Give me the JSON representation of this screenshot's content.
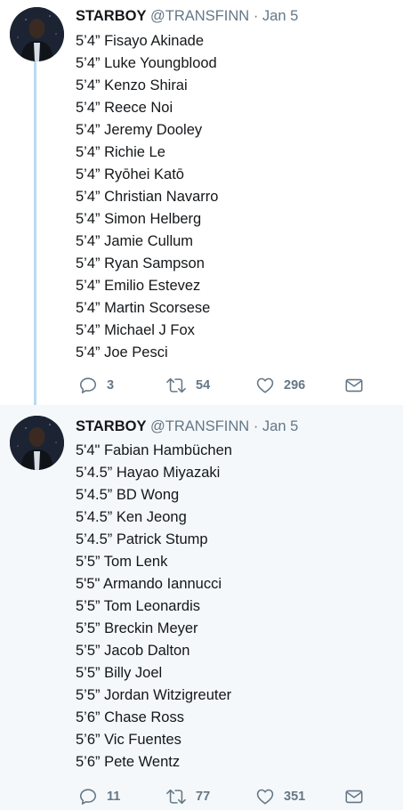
{
  "tweets": [
    {
      "author": {
        "name": "STARBOY",
        "handle": "@TRANSFINN",
        "separator": "·",
        "date": "Jan 5"
      },
      "lines": [
        "5’4” Fisayo Akinade",
        "5’4” Luke Youngblood",
        "5’4” Kenzo Shirai",
        "5’4” Reece Noi",
        "5’4” Jeremy Dooley",
        "5’4” Richie Le",
        "5’4” Ryōhei Katō",
        "5’4” Christian Navarro",
        "5’4” Simon Helberg",
        "5’4” Jamie Cullum",
        "5’4” Ryan Sampson",
        "5’4” Emilio Estevez",
        "5’4” Martin Scorsese",
        "5’4” Michael J Fox",
        "5’4” Joe Pesci"
      ],
      "actions": {
        "replies": "3",
        "retweets": "54",
        "likes": "296"
      }
    },
    {
      "author": {
        "name": "STARBOY",
        "handle": "@TRANSFINN",
        "separator": "·",
        "date": "Jan 5"
      },
      "lines": [
        "5'4\" Fabian Hambüchen",
        "5’4.5” Hayao Miyazaki",
        "5’4.5” BD Wong",
        "5’4.5” Ken Jeong",
        "5’4.5” Patrick Stump",
        "5’5” Tom Lenk",
        "5'5\" Armando Iannucci",
        "5’5” Tom Leonardis",
        "5’5” Breckin Meyer",
        "5’5” Jacob Dalton",
        "5’5” Billy Joel",
        "5’5” Jordan Witzigreuter",
        "5’6” Chase Ross",
        "5’6” Vic Fuentes",
        "5’6” Pete Wentz"
      ],
      "actions": {
        "replies": "11",
        "retweets": "77",
        "likes": "351"
      }
    }
  ],
  "colors": {
    "accent_thread": "#b8dbf1",
    "secondary_text": "#657786",
    "highlight_bg": "#f5f8fa"
  },
  "icons": {
    "reply": "reply-icon",
    "retweet": "retweet-icon",
    "like": "heart-icon",
    "dm": "envelope-icon"
  }
}
